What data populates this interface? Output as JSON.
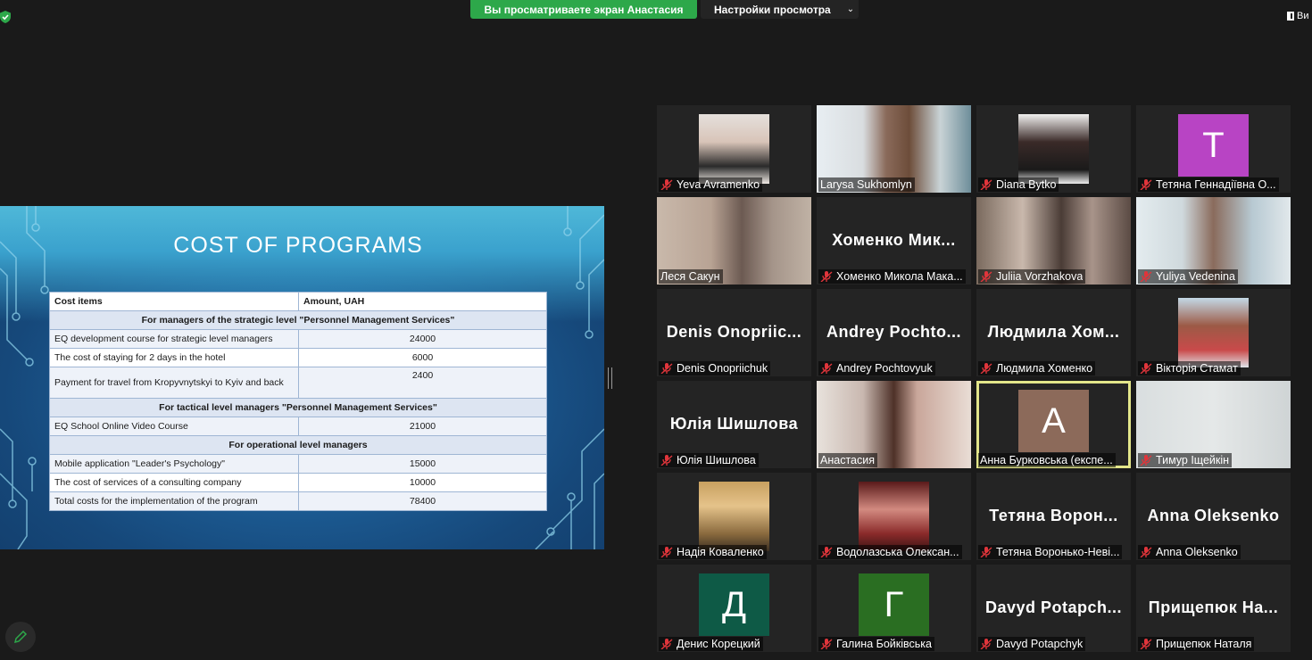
{
  "banner": {
    "sharing_text": "Вы просматриваете экран Анастасия",
    "view_options_label": "Настройки просмотра",
    "view_button_label": "Ви"
  },
  "slide": {
    "title": "COST OF PROGRAMS",
    "table": {
      "header": [
        "Cost items",
        "Amount, UAH"
      ],
      "rows": [
        {
          "type": "section",
          "label": "For managers of the strategic level \"Personnel Management Services\""
        },
        {
          "type": "item",
          "label": "EQ development course for strategic level managers",
          "amount": "24000"
        },
        {
          "type": "item",
          "label": "The cost of staying for 2 days in the hotel",
          "amount": "6000"
        },
        {
          "type": "item",
          "label": "Payment for travel from Kropyvnytskyi to Kyiv and back",
          "amount": "2400"
        },
        {
          "type": "section",
          "label": "For tactical level managers \"Personnel Management Services\""
        },
        {
          "type": "item",
          "label": "EQ School Online Video Course",
          "amount": "21000"
        },
        {
          "type": "section",
          "label": "For operational level managers"
        },
        {
          "type": "item",
          "label": "Mobile application \"Leader's Psychology\"",
          "amount": "15000"
        },
        {
          "type": "item",
          "label": "The cost of services of a consulting company",
          "amount": "10000"
        },
        {
          "type": "item",
          "label": "Total costs for the implementation of the program",
          "amount": "78400"
        }
      ]
    }
  },
  "participants": [
    {
      "name": "Yeva Avramenko",
      "muted": true,
      "kind": "photo"
    },
    {
      "name": "Larysa Sukhomlyn",
      "muted": false,
      "kind": "video"
    },
    {
      "name": "Diana Bytko",
      "muted": true,
      "kind": "photo"
    },
    {
      "name": "Тетяна Геннадіївна О...",
      "muted": true,
      "kind": "letter",
      "letter": "T",
      "color": "#b844c4"
    },
    {
      "name": "Леся Сакун",
      "muted": false,
      "kind": "video"
    },
    {
      "name": "Хоменко Микола Мака...",
      "muted": true,
      "kind": "text",
      "display": "Хоменко Мик..."
    },
    {
      "name": "Juliia Vorzhakova",
      "muted": true,
      "kind": "video"
    },
    {
      "name": "Yuliya Vedenina",
      "muted": true,
      "kind": "video"
    },
    {
      "name": "Denis Onopriichuk",
      "muted": true,
      "kind": "text",
      "display": "Denis Onopriic..."
    },
    {
      "name": "Andrey Pochtovyuk",
      "muted": true,
      "kind": "text",
      "display": "Andrey Pochto..."
    },
    {
      "name": "Людмила Хоменко",
      "muted": true,
      "kind": "text",
      "display": "Людмила Хом..."
    },
    {
      "name": "Вікторія Стамат",
      "muted": true,
      "kind": "photo"
    },
    {
      "name": "Юлія Шишлова",
      "muted": true,
      "kind": "text",
      "display": "Юлія Шишлова"
    },
    {
      "name": "Анастасия",
      "muted": false,
      "kind": "video"
    },
    {
      "name": "Анна Бурковська (експе...",
      "muted": false,
      "kind": "letter",
      "letter": "A",
      "color": "#8c6a5a"
    },
    {
      "name": "Тимур Іщейкін",
      "muted": true,
      "kind": "video"
    },
    {
      "name": "Надія Коваленко",
      "muted": true,
      "kind": "photo"
    },
    {
      "name": "Водолазська Олексан...",
      "muted": true,
      "kind": "photo"
    },
    {
      "name": "Тетяна Воронько-Неві...",
      "muted": true,
      "kind": "text",
      "display": "Тетяна Ворон..."
    },
    {
      "name": "Anna Oleksenko",
      "muted": true,
      "kind": "text",
      "display": "Anna Oleksenko"
    },
    {
      "name": "Денис Корецкий",
      "muted": true,
      "kind": "letter",
      "letter": "Д",
      "color": "#0e5a46"
    },
    {
      "name": "Галина Бойківська",
      "muted": true,
      "kind": "letter",
      "letter": "Г",
      "color": "#2a6e22"
    },
    {
      "name": "Davyd Potapchyk",
      "muted": true,
      "kind": "text",
      "display": "Davyd Potapch..."
    },
    {
      "name": "Прищепюк Наталя",
      "muted": true,
      "kind": "text",
      "display": "Прищепюк На..."
    }
  ],
  "colors": {
    "banner_green": "#2da84a",
    "active_speaker": "#e3e68a",
    "mute_red": "#e0353b"
  }
}
